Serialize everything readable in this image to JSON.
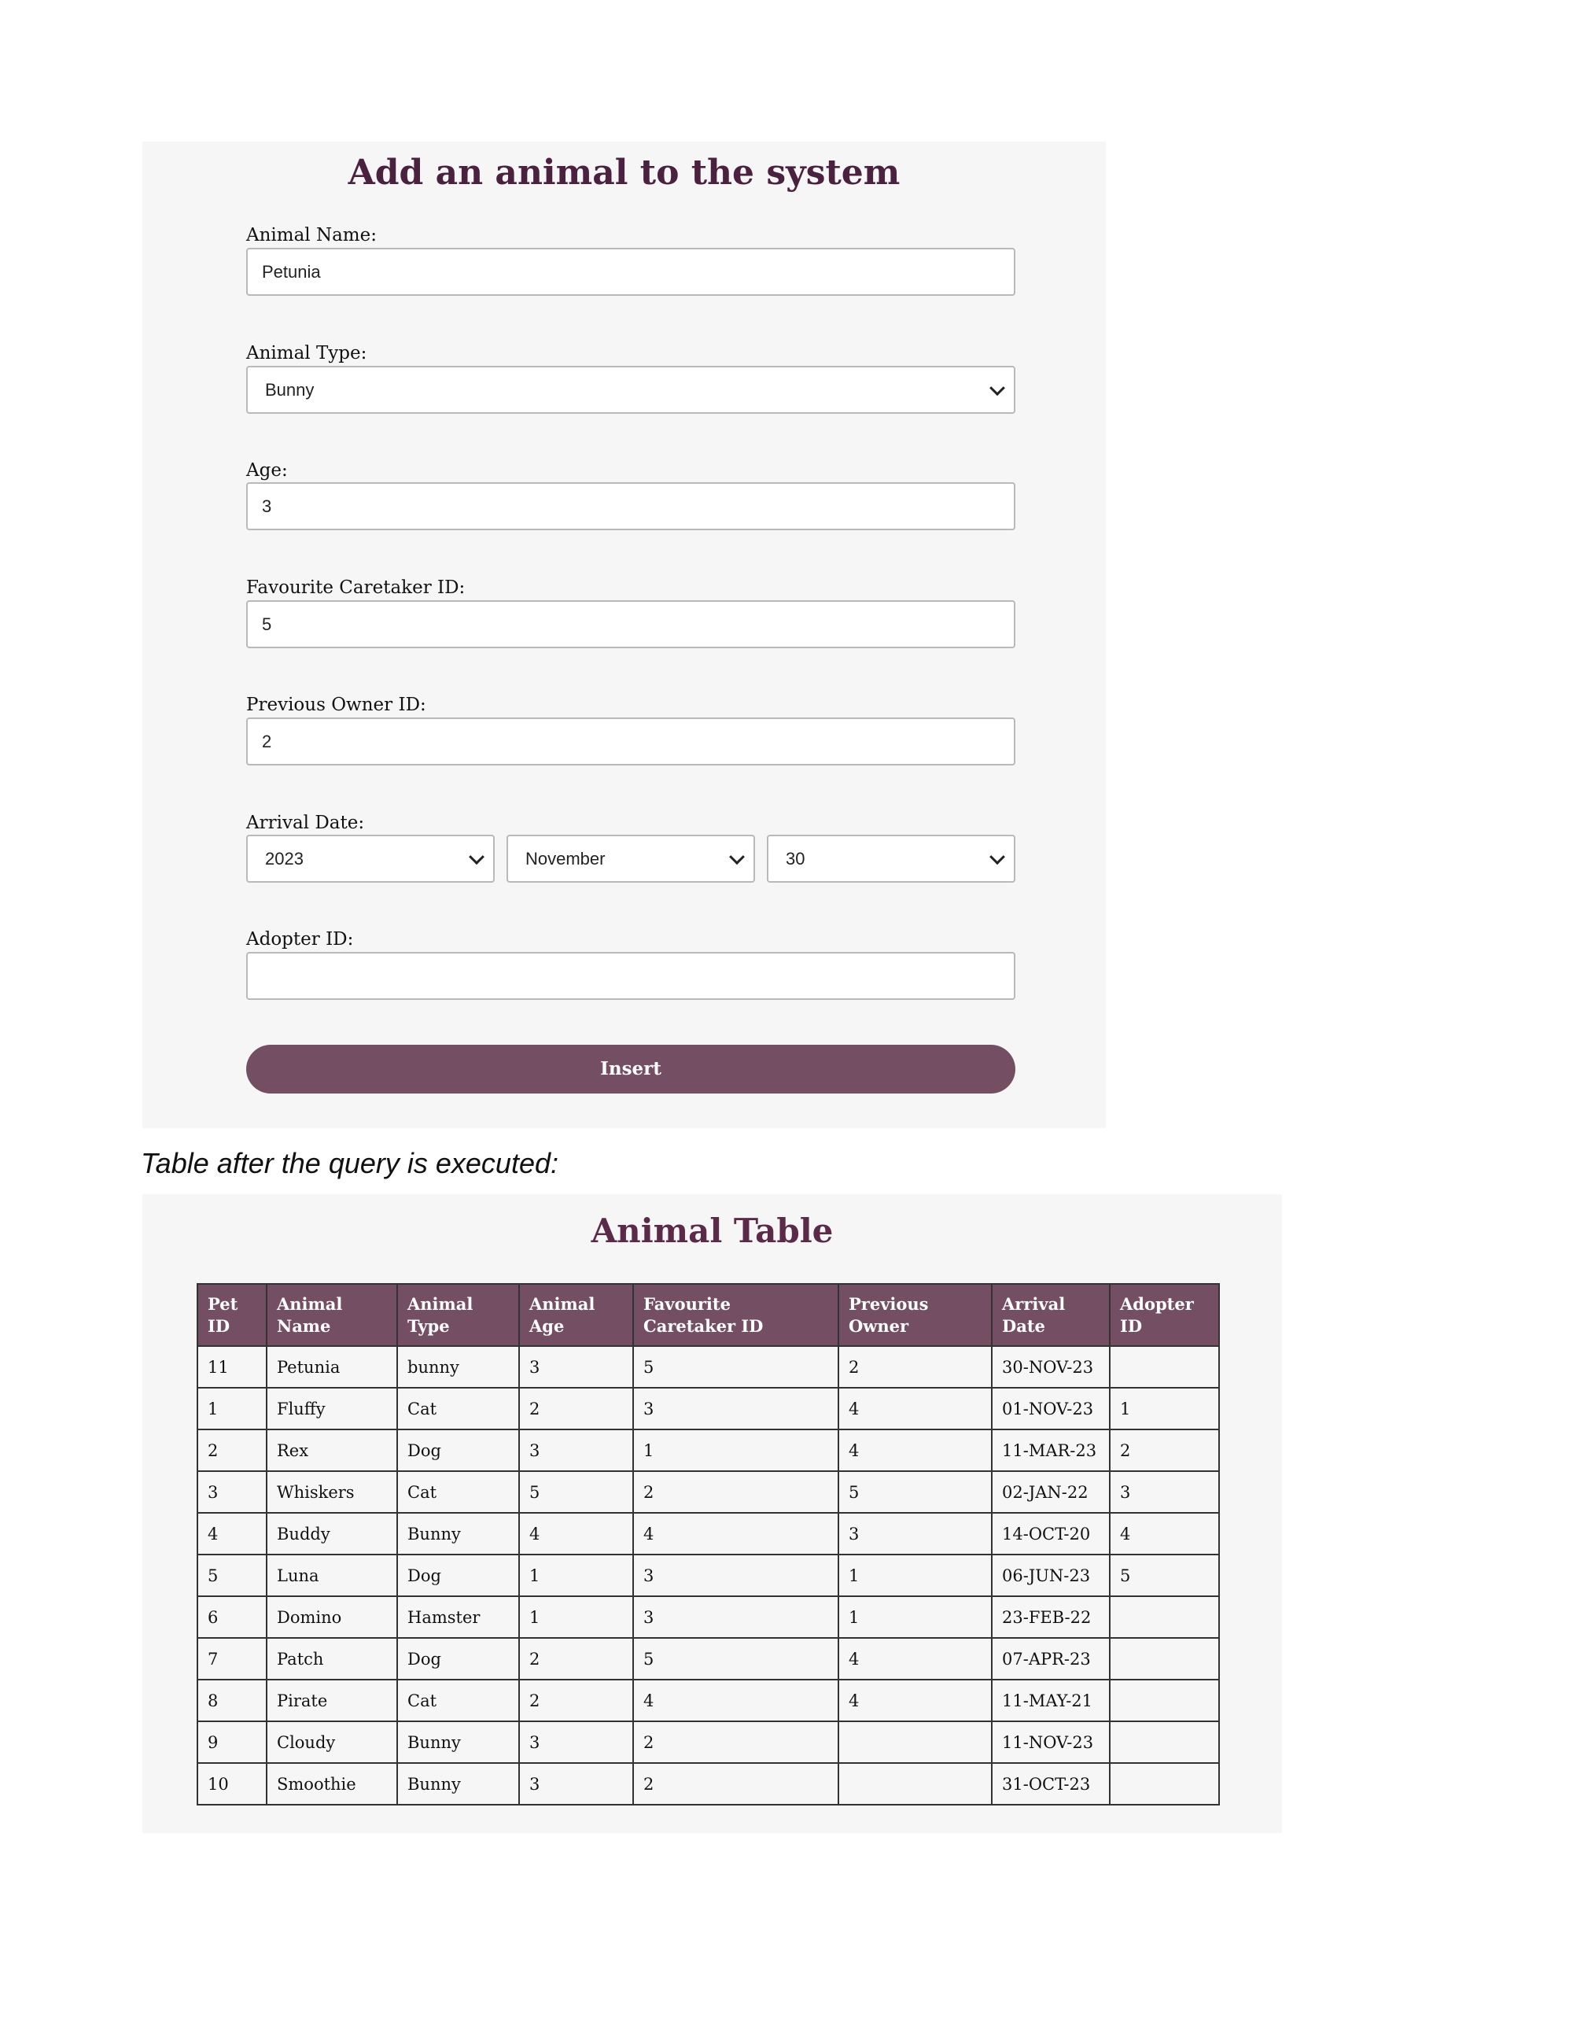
{
  "form": {
    "title": "Add an animal to the system",
    "fields": {
      "animal_name": {
        "label": "Animal Name:",
        "value": "Petunia"
      },
      "animal_type": {
        "label": "Animal Type:",
        "value": "Bunny"
      },
      "age": {
        "label": "Age:",
        "value": "3"
      },
      "favourite_caretaker_id": {
        "label": "Favourite Caretaker ID:",
        "value": "5"
      },
      "previous_owner_id": {
        "label": "Previous Owner ID:",
        "value": "2"
      },
      "arrival_date": {
        "label": "Arrival Date:",
        "year": "2023",
        "month": "November",
        "day": "30"
      },
      "adopter_id": {
        "label": "Adopter ID:",
        "value": ""
      }
    },
    "insert_label": "Insert"
  },
  "caption": "Table after the query is executed:",
  "table": {
    "title": "Animal Table",
    "headers": [
      "Pet ID",
      "Animal Name",
      "Animal Type",
      "Animal Age",
      "Favourite Caretaker ID",
      "Previous Owner",
      "Arrival Date",
      "Adopter ID"
    ],
    "rows": [
      [
        "11",
        "Petunia",
        "bunny",
        "3",
        "5",
        "2",
        "30-NOV-23",
        ""
      ],
      [
        "1",
        "Fluffy",
        "Cat",
        "2",
        "3",
        "4",
        "01-NOV-23",
        "1"
      ],
      [
        "2",
        "Rex",
        "Dog",
        "3",
        "1",
        "4",
        "11-MAR-23",
        "2"
      ],
      [
        "3",
        "Whiskers",
        "Cat",
        "5",
        "2",
        "5",
        "02-JAN-22",
        "3"
      ],
      [
        "4",
        "Buddy",
        "Bunny",
        "4",
        "4",
        "3",
        "14-OCT-20",
        "4"
      ],
      [
        "5",
        "Luna",
        "Dog",
        "1",
        "3",
        "1",
        "06-JUN-23",
        "5"
      ],
      [
        "6",
        "Domino",
        "Hamster",
        "1",
        "3",
        "1",
        "23-FEB-22",
        ""
      ],
      [
        "7",
        "Patch",
        "Dog",
        "2",
        "5",
        "4",
        "07-APR-23",
        ""
      ],
      [
        "8",
        "Pirate",
        "Cat",
        "2",
        "4",
        "4",
        "11-MAY-21",
        ""
      ],
      [
        "9",
        "Cloudy",
        "Bunny",
        "3",
        "2",
        "",
        "11-NOV-23",
        ""
      ],
      [
        "10",
        "Smoothie",
        "Bunny",
        "3",
        "2",
        "",
        "31-OCT-23",
        ""
      ]
    ]
  }
}
